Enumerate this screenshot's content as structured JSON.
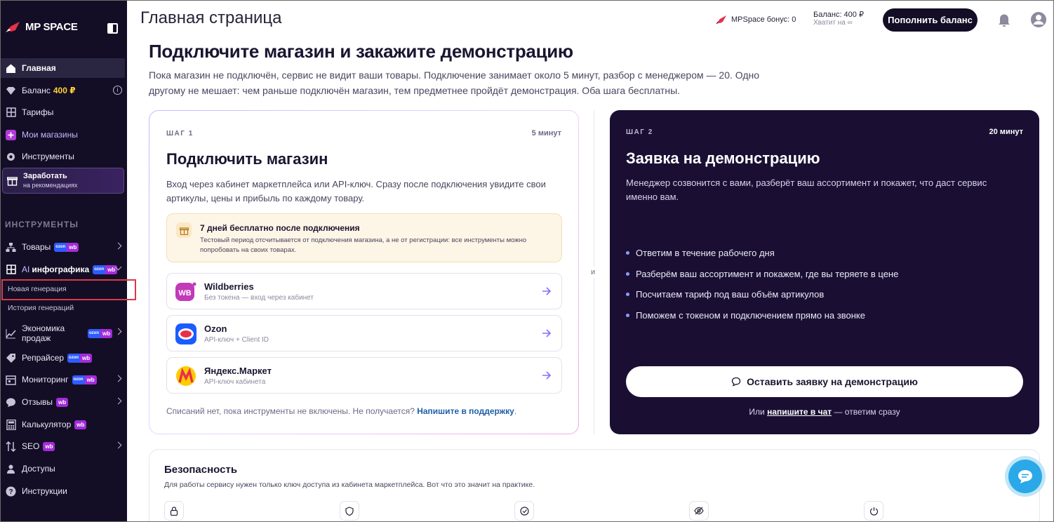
{
  "app": {
    "logo_text": "MP SPACE"
  },
  "sidebar": {
    "items": [
      {
        "label": "Главная"
      },
      {
        "label": "Баланс",
        "amount": "400 ₽"
      },
      {
        "label": "Тарифы"
      },
      {
        "label": "Мои магазины"
      },
      {
        "label": "Инструменты"
      }
    ],
    "earn": {
      "title": "Заработать",
      "subtitle": "на рекомендациях"
    },
    "section_label": "ИНСТРУМЕНТЫ",
    "tools": [
      {
        "label": "Товары",
        "badge_oz": "ozon",
        "badge_wb": "wb"
      },
      {
        "label_prefix": "AI",
        "label": "инфографика",
        "badge_oz": "ozon",
        "badge_wb": "wb"
      },
      {
        "label": "Новая генерация"
      },
      {
        "label": "История генераций"
      },
      {
        "label_line1": "Экономика",
        "label_line2": "продаж",
        "badge_oz": "ozon",
        "badge_wb": "wb"
      },
      {
        "label": "Репрайсер",
        "badge_oz": "ozon",
        "badge_wb": "wb"
      },
      {
        "label": "Мониторинг",
        "badge_oz": "ozon",
        "badge_wb": "wb"
      },
      {
        "label": "Отзывы",
        "badge_wb": "wb"
      },
      {
        "label": "Калькулятор",
        "badge_wb": "wb"
      },
      {
        "label": "SEO",
        "badge_wb": "wb"
      },
      {
        "label": "Доступы"
      },
      {
        "label": "Инструкции"
      }
    ]
  },
  "header": {
    "title": "Главная страница",
    "bonus": "MPSpace бонус: 0",
    "balance": "Баланс: 400 ₽",
    "balance_sub": "Хватит на ∞",
    "topup": "Пополнить баланс"
  },
  "main": {
    "headline": "Подключите магазин и закажите демонстрацию",
    "lead": "Пока магазин не подключён, сервис не видит ваши товары. Подключение занимает около 5 минут, разбор с менеджером — 20. Одно другому не мешает: чем раньше подключён магазин, тем предметнее пройдёт демонстрация. Оба шага бесплатны.",
    "and": "и"
  },
  "step1": {
    "label": "ШАГ 1",
    "time": "5 минут",
    "title": "Подключить магазин",
    "desc": "Вход через кабинет маркетплейса или API-ключ. Сразу после подключения увидите свои артикулы, цены и прибыль по каждому товару.",
    "trial_title": "7 дней бесплатно после подключения",
    "trial_desc": "Тестовый период отсчитывается от подключения магазина, а не от регистрации: все инструменты можно попробовать на своих товарах.",
    "marketplaces": [
      {
        "name": "Wildberries",
        "sub": "Без токена — вход через кабинет",
        "icon_text": "WB"
      },
      {
        "name": "Ozon",
        "sub": "API-ключ + Client ID"
      },
      {
        "name": "Яндекс.Маркет",
        "sub": "API-ключ кабинета"
      }
    ],
    "foot_text": "Списаний нет, пока инструменты не включены. Не получается?",
    "foot_link": "Напишите в поддержку",
    "foot_end": "."
  },
  "step2": {
    "label": "ШАГ 2",
    "time": "20 минут",
    "title": "Заявка на демонстрацию",
    "desc": "Менеджер созвонится с вами, разберёт ваш ассортимент и покажет, что даст сервис именно вам.",
    "bullets": [
      "Ответим в течение рабочего дня",
      "Разберём ваш ассортимент и покажем, где вы теряете в цене",
      "Посчитаем тариф под ваш объём артикулов",
      "Поможем с токеном и подключением прямо на звонке"
    ],
    "button": "Оставить заявку на демонстрацию",
    "chat_prefix": "Или",
    "chat_link": "напишите в чат",
    "chat_suffix": "— ответим сразу"
  },
  "security": {
    "title": "Безопасность",
    "desc": "Для работы сервису нужен только ключ доступа из кабинета маркетплейса. Вот что это значит на практике."
  },
  "colors": {
    "sidebar_bg": "#130e26",
    "dark_card": "#1a0f33",
    "accent_link": "#1f5fa8",
    "chat_fab": "#2ba8e8"
  }
}
